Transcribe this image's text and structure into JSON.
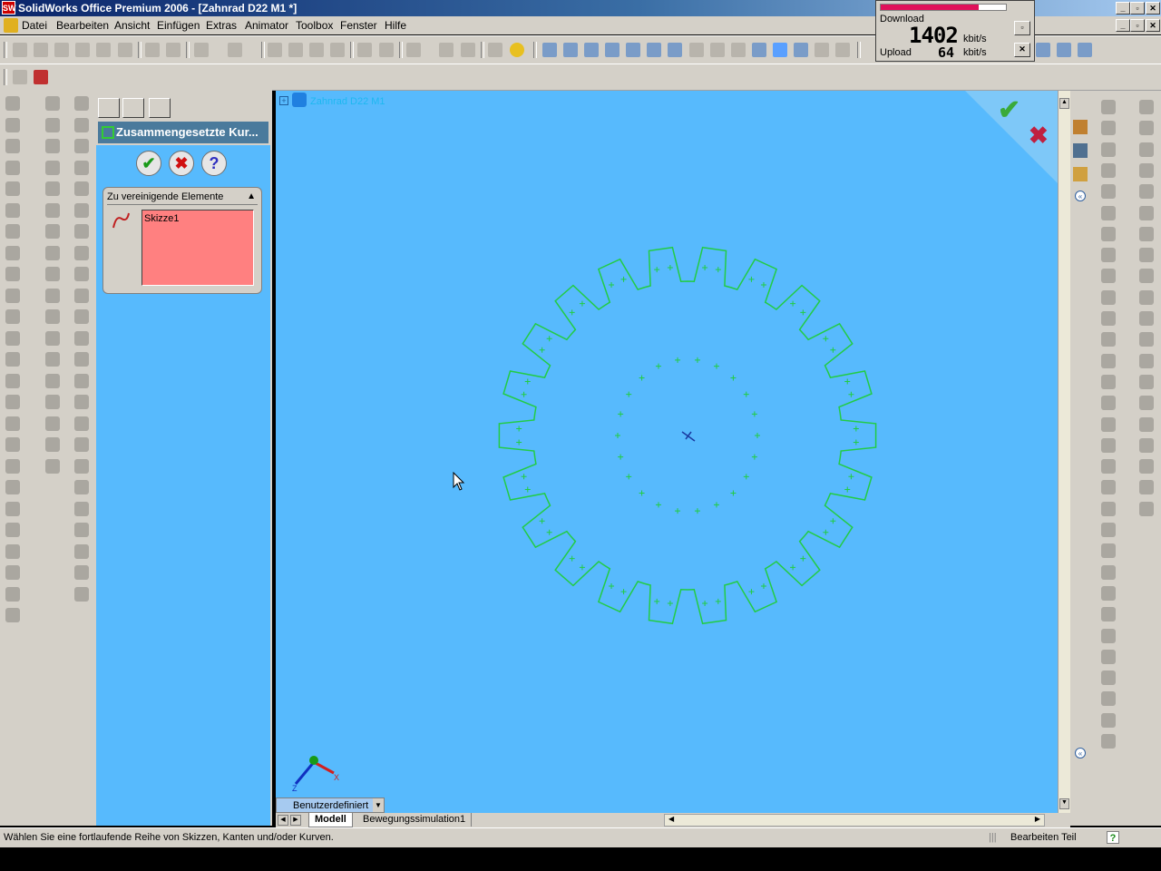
{
  "window": {
    "title": "SolidWorks Office Premium 2006 - [Zahnrad D22 M1 *]",
    "controls": [
      "minimize",
      "maximize",
      "close"
    ]
  },
  "menu": {
    "items": [
      "Datei",
      "Bearbeiten",
      "Ansicht",
      "Einfügen",
      "Extras",
      "Animator",
      "Toolbox",
      "Fenster",
      "Hilfe"
    ]
  },
  "netmon": {
    "download_label": "Download",
    "download_value": "1402",
    "download_unit": "kbit/s",
    "upload_label": "Upload",
    "upload_value": "64",
    "upload_unit": "kbit/s",
    "download_level": 0.78,
    "bar_color": "#e0105a"
  },
  "property_manager": {
    "title": "Zusammengesetzte Kur...",
    "ok_symbol": "✔",
    "cancel_symbol": "✖",
    "help_symbol": "?",
    "group_title": "Zu vereinigende Elemente",
    "selection_items": [
      "Skizze1"
    ],
    "list_color": "#ff8080"
  },
  "graphics": {
    "tree_root": "Zahnrad D22 M1",
    "background_color": "#57bafd",
    "sketch_color": "#22cc44",
    "view_orientation": "Benutzerdefiniert",
    "axis_labels": {
      "x": "X",
      "y": "Y",
      "z": "Z"
    }
  },
  "model_tabs": {
    "tabs": [
      "Modell",
      "Bewegungssimulation1"
    ],
    "active": "Modell"
  },
  "statusbar": {
    "message": "Wählen Sie eine fortlaufende Reihe von Skizzen, Kanten und/oder Kurven.",
    "mode": "Bearbeiten Teil",
    "help_symbol": "?"
  }
}
